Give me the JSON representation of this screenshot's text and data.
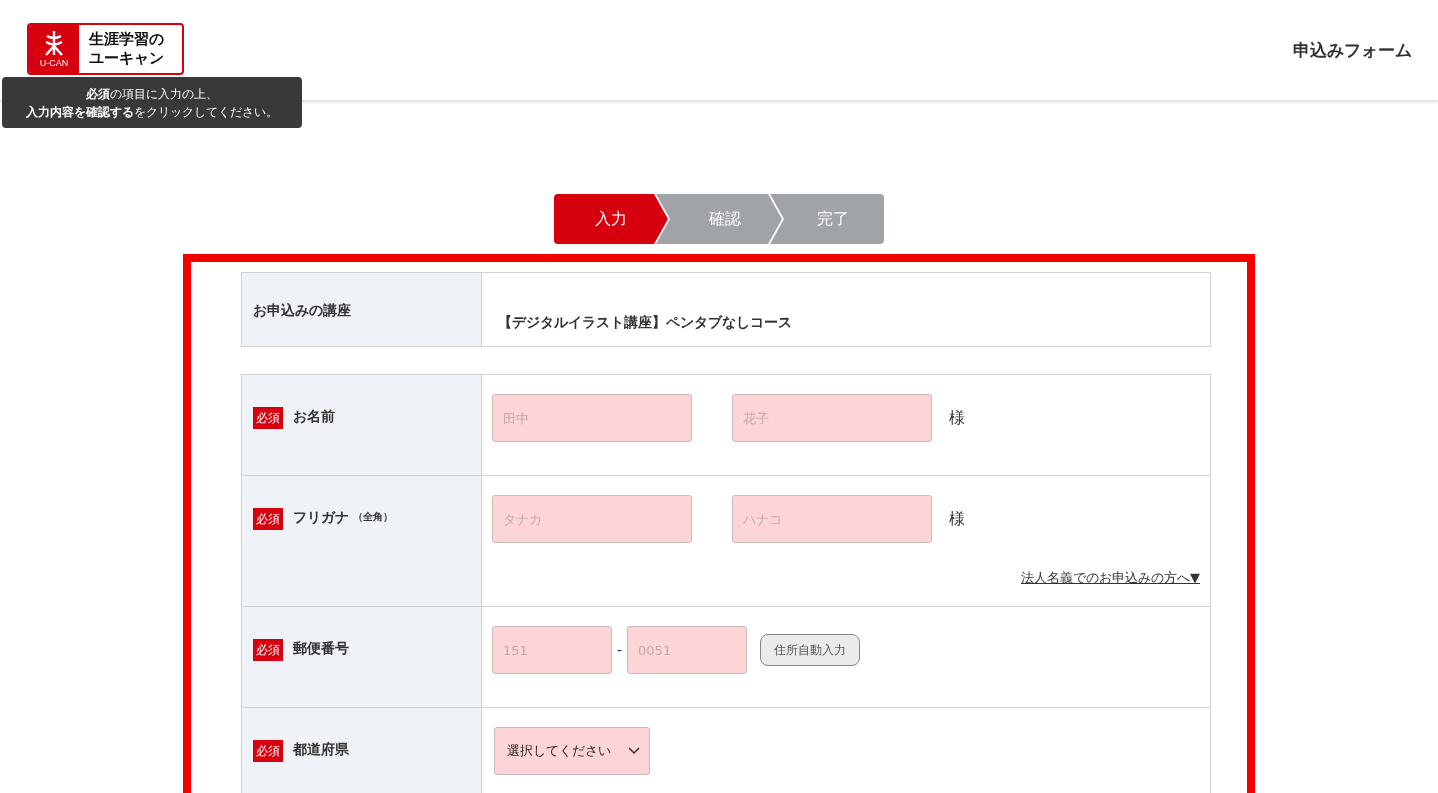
{
  "header": {
    "logo": {
      "mark": "U-CAN",
      "tagline": "生涯学習の",
      "name": "ユーキャン"
    },
    "title": "申込みフォーム"
  },
  "tooltip": {
    "lines": [
      "**必須**の項目に入力の上、",
      "**入力内容を確認する**をクリックしてください。"
    ]
  },
  "steps": [
    {
      "label": "入力",
      "selected": true
    },
    {
      "label": "確認",
      "selected": false
    },
    {
      "label": "完了",
      "selected": false
    }
  ],
  "course": {
    "label": "お申込みの講座",
    "value": "【デジタルイラスト講座】ペンタブなしコース"
  },
  "fields": [
    {
      "kind": "name",
      "badge": "必須",
      "label": "お名前",
      "inputs": [
        {
          "placeholder": "田中"
        },
        {
          "placeholder": "花子"
        }
      ],
      "suffix": "様"
    },
    {
      "kind": "name",
      "badge": "必須",
      "label": "フリガナ",
      "note": "（全角）",
      "inputs": [
        {
          "placeholder": "タナカ"
        },
        {
          "placeholder": "ハナコ"
        }
      ],
      "suffix": "様",
      "link": "法人名義でのお申込みの方へ▼"
    },
    {
      "kind": "postal",
      "badge": "必須",
      "label": "郵便番号",
      "inputs": [
        {
          "placeholder": "151"
        },
        {
          "placeholder": "0051"
        }
      ],
      "separator": "-",
      "button": "住所自動入力"
    },
    {
      "kind": "select",
      "badge": "必須",
      "label": "都道府県",
      "value": "選択してください"
    }
  ]
}
